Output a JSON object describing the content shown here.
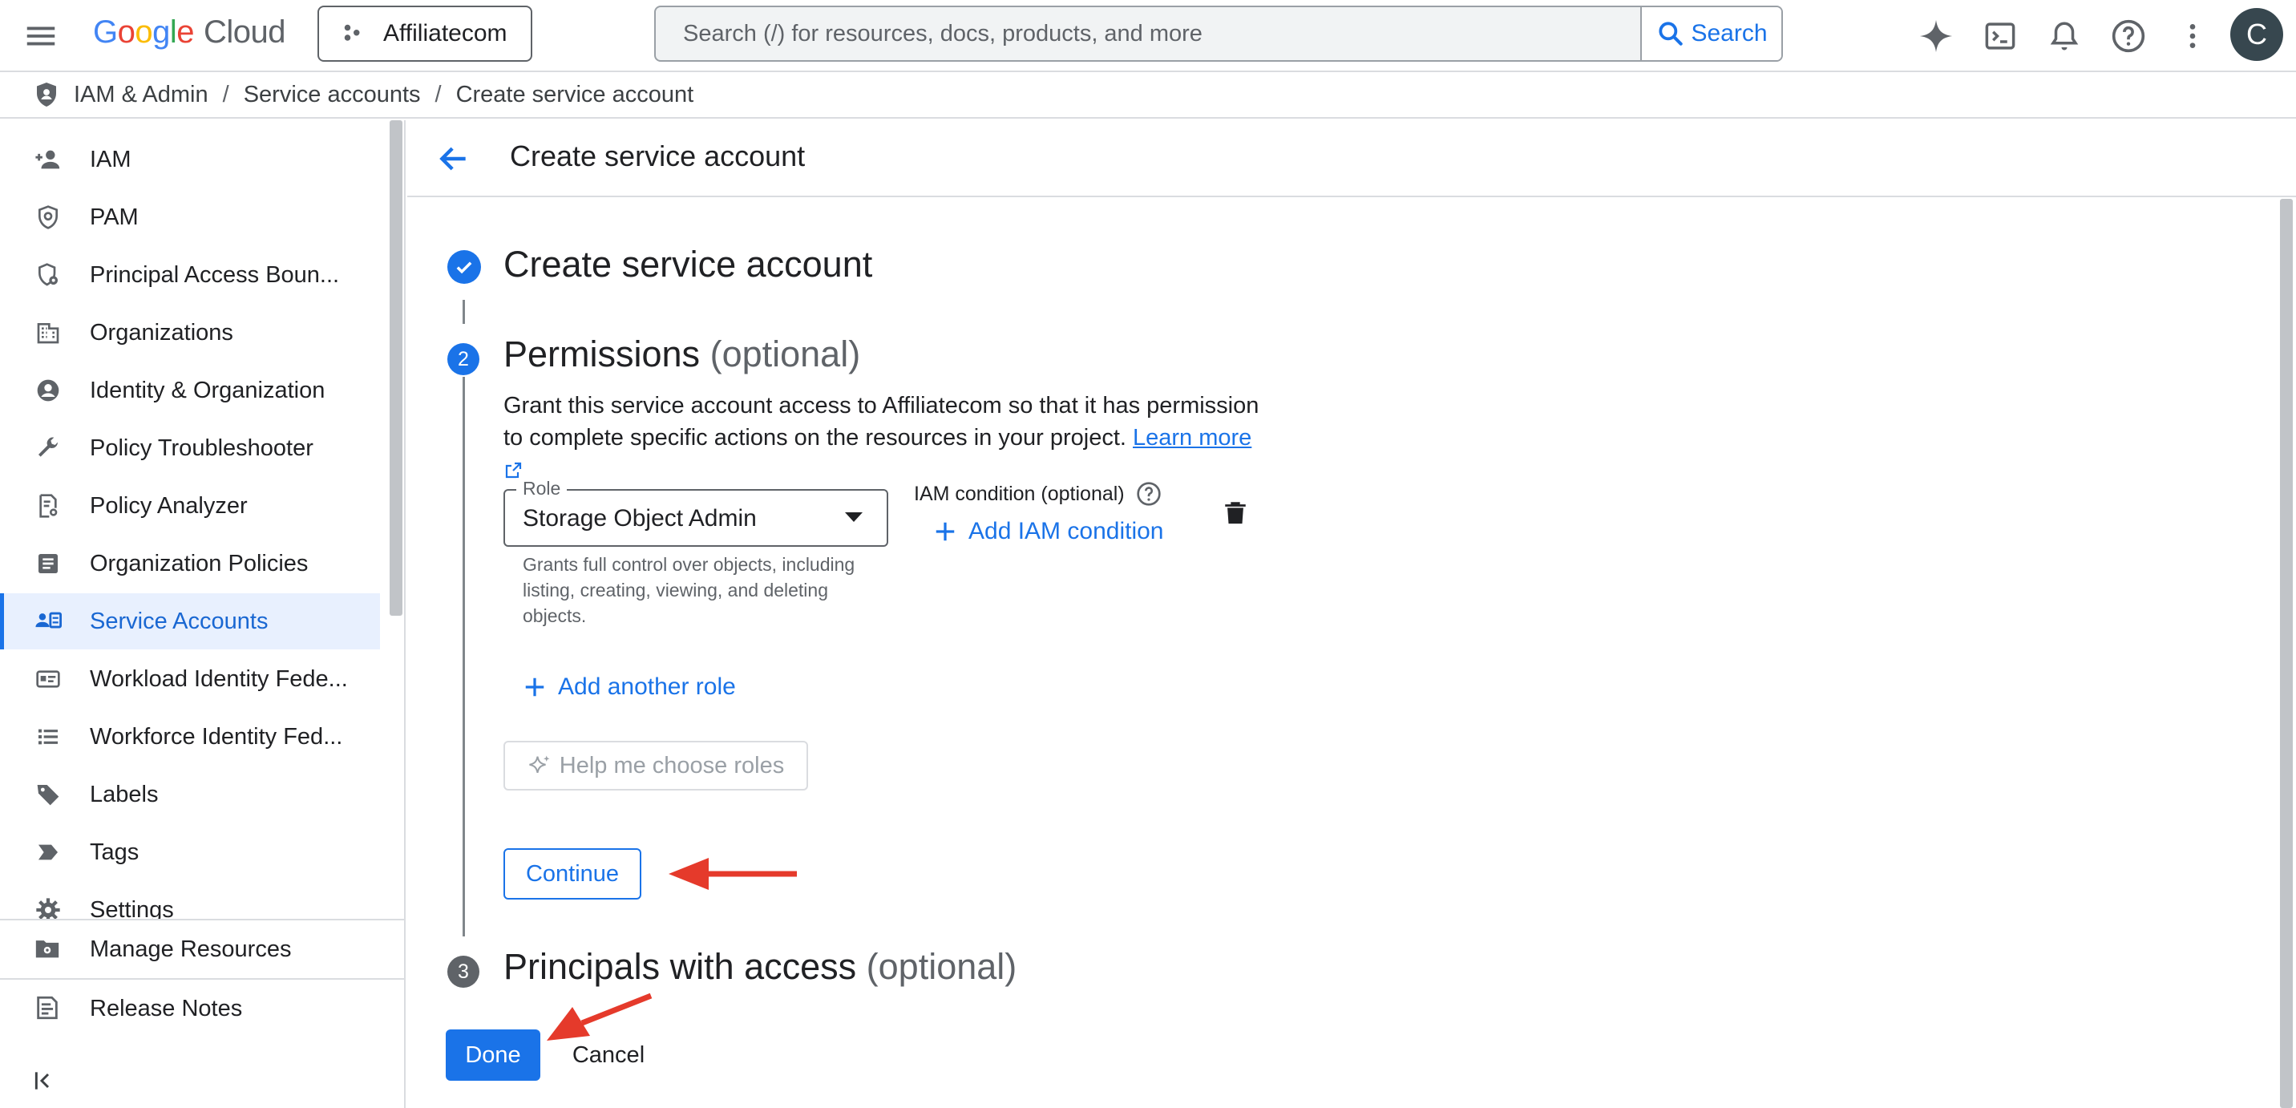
{
  "topbar": {
    "logo_google_letters": [
      "G",
      "o",
      "o",
      "g",
      "l",
      "e"
    ],
    "logo_cloud": "Cloud",
    "project_name": "Affiliatecom",
    "search_placeholder": "Search (/) for resources, docs, products, and more",
    "search_label": "Search",
    "avatar_initial": "C"
  },
  "breadcrumb": {
    "items": [
      "IAM & Admin",
      "Service accounts",
      "Create service account"
    ],
    "separator": "/"
  },
  "sidebar": {
    "items": [
      {
        "label": "IAM",
        "icon": "person-add-icon"
      },
      {
        "label": "PAM",
        "icon": "shield-icon"
      },
      {
        "label": "Principal Access Boun...",
        "icon": "shield-gear-icon"
      },
      {
        "label": "Organizations",
        "icon": "building-icon"
      },
      {
        "label": "Identity & Organization",
        "icon": "account-circle-icon"
      },
      {
        "label": "Policy Troubleshooter",
        "icon": "wrench-icon"
      },
      {
        "label": "Policy Analyzer",
        "icon": "document-search-icon"
      },
      {
        "label": "Organization Policies",
        "icon": "list-document-icon"
      },
      {
        "label": "Service Accounts",
        "icon": "service-account-icon",
        "active": true
      },
      {
        "label": "Workload Identity Fede...",
        "icon": "id-card-icon"
      },
      {
        "label": "Workforce Identity Fed...",
        "icon": "list-icon"
      },
      {
        "label": "Labels",
        "icon": "label-icon"
      },
      {
        "label": "Tags",
        "icon": "tag-icon"
      },
      {
        "label": "Settings",
        "icon": "gear-icon"
      }
    ],
    "manage_resources": "Manage Resources",
    "release_notes": "Release Notes"
  },
  "page": {
    "title": "Create service account"
  },
  "steps": {
    "step1_title": "Create service account",
    "step2_number": "2",
    "step2_title": "Permissions",
    "step2_optional": "(optional)",
    "step2_description": "Grant this service account access to Affiliatecom so that it has permission to complete specific actions on the resources in your project.",
    "learn_more": "Learn more",
    "role_legend": "Role",
    "role_value": "Storage Object Admin",
    "role_help": "Grants full control over objects, including listing, creating, viewing, and deleting objects.",
    "iam_condition_label": "IAM condition (optional)",
    "add_iam_condition": "Add IAM condition",
    "add_another_role": "Add another role",
    "help_me_choose": "Help me choose roles",
    "continue": "Continue",
    "step3_number": "3",
    "step3_title": "Principals with access",
    "step3_optional": "(optional)"
  },
  "footer": {
    "done": "Done",
    "cancel": "Cancel"
  },
  "colors": {
    "primary": "#1a73e8",
    "active_bg": "#e8f0fe",
    "annotation_arrow": "#e53a2b",
    "step3_circle": "#5f6368"
  }
}
